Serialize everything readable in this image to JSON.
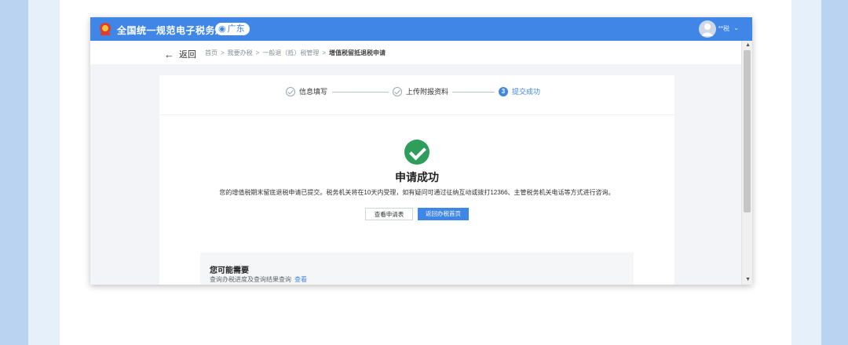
{
  "header": {
    "app_title": "全国统一规范电子税务局",
    "region": "广东",
    "user_name": "**税"
  },
  "breadcrumb": {
    "back_label": "返回",
    "items": [
      "首页",
      "我要办税",
      "一般退（抵）税管理",
      "增值税留抵退税申请"
    ]
  },
  "steps": [
    {
      "label": "信息填写",
      "state": "done"
    },
    {
      "label": "上传附报资料",
      "state": "done"
    },
    {
      "label": "提交成功",
      "number": "3",
      "state": "current"
    }
  ],
  "result": {
    "title": "申请成功",
    "description": "您的增值税期末留底退税申请已提交。税务机关将在10天内受理，如有疑问可通过征纳互动或拨打12366、主管税务机关电话等方式进行咨询。",
    "view_button": "查看申请表",
    "home_button": "返回办税首页"
  },
  "suggestions": {
    "title": "您可能需要",
    "line_text": "查询办税进度及查询结果查询",
    "line_link": "查看"
  },
  "colors": {
    "primary": "#3f86e6",
    "success": "#2f9e5a"
  }
}
